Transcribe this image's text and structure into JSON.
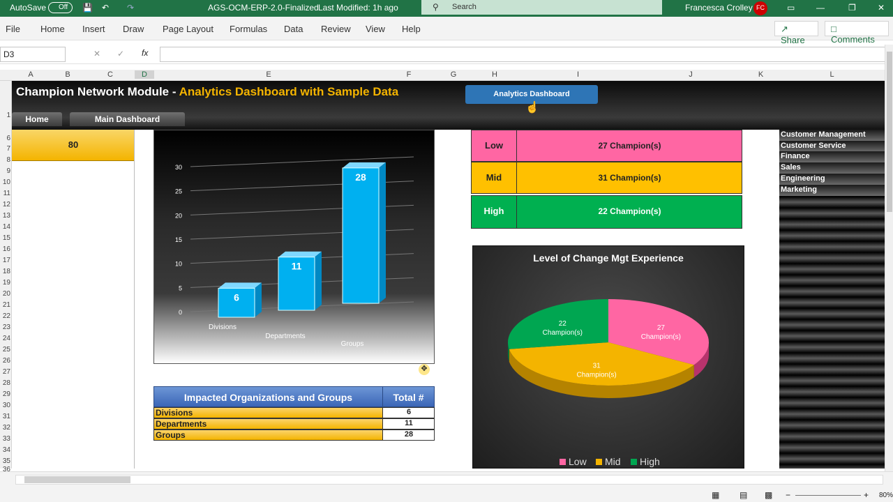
{
  "titlebar": {
    "autosave": "AutoSave",
    "autosave_state": "Off",
    "filename": "AGS-OCM-ERP-2.0-Finalized",
    "modified": "Last Modified: 1h ago",
    "search": "Search",
    "user": "Francesca Crolley",
    "initials": "FC"
  },
  "ribbon": {
    "tabs": [
      "File",
      "Home",
      "Insert",
      "Draw",
      "Page Layout",
      "Formulas",
      "Data",
      "Review",
      "View",
      "Help"
    ],
    "share": "Share",
    "comments": "Comments"
  },
  "formula": {
    "namebox": "D3",
    "fx": "fx"
  },
  "columns": [
    "A",
    "B",
    "C",
    "D",
    "E",
    "F",
    "G",
    "H",
    "I",
    "J",
    "K",
    "L"
  ],
  "rows": [
    "1",
    "6",
    "7",
    "8",
    "9",
    "10",
    "11",
    "12",
    "13",
    "14",
    "15",
    "16",
    "17",
    "18",
    "19",
    "20",
    "21",
    "22",
    "23",
    "24",
    "25",
    "26",
    "27",
    "28",
    "29",
    "30",
    "31",
    "32",
    "33",
    "34",
    "35",
    "36"
  ],
  "header": {
    "title": "Champion Network Module - ",
    "subtitle": "Analytics Dashboard with Sample Data",
    "analytics_btn": "Analytics Dashboard",
    "home_btn": "Home",
    "main_btn": "Main Dashboard"
  },
  "summary": {
    "value": "80"
  },
  "chart_data": [
    {
      "type": "bar",
      "categories": [
        "Divisions",
        "Departments",
        "Groups"
      ],
      "values": [
        6,
        11,
        28
      ],
      "ylim": [
        0,
        30
      ],
      "yticks": [
        "0",
        "5",
        "10",
        "15",
        "20",
        "25",
        "30"
      ],
      "title": "",
      "colors": {
        "bar": "#00b0f0"
      }
    },
    {
      "type": "pie",
      "title": "Level of Change Mgt Experience",
      "labels": [
        "Low",
        "Mid",
        "High"
      ],
      "values": [
        27,
        31,
        22
      ],
      "slice_labels": [
        "27",
        "31",
        "22"
      ],
      "slice_sub": "Champion(s)",
      "colors": [
        "#ff66a3",
        "#f4b400",
        "#00a651"
      ],
      "legend": "bottom"
    }
  ],
  "table": {
    "header": "Impacted Organizations and Groups",
    "total_header": "Total #",
    "rows": [
      {
        "name": "Divisions",
        "value": "6"
      },
      {
        "name": "Departments",
        "value": "11"
      },
      {
        "name": "Groups",
        "value": "28"
      }
    ]
  },
  "levels": [
    {
      "label": "Low",
      "text": "27 Champion(s)",
      "color": "#ff66a3"
    },
    {
      "label": "Mid",
      "text": "31 Champion(s)",
      "color": "#f4b400"
    },
    {
      "label": "High",
      "text": "22 Champion(s)",
      "color": "#00b050"
    }
  ],
  "sidebar": [
    "Customer Management",
    "Customer Service",
    "Finance",
    "Sales",
    "Engineering",
    "Marketing"
  ],
  "status": {
    "zoom": "80%"
  }
}
